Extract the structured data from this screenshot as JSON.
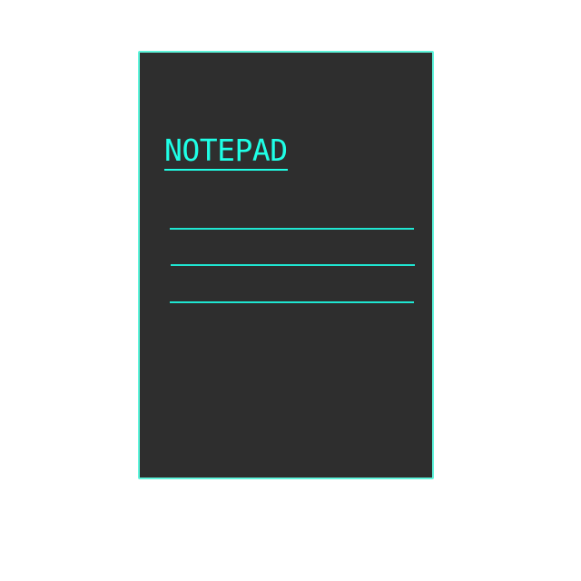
{
  "notepad": {
    "title": "NOTEPAD"
  },
  "colors": {
    "background": "#ffffff",
    "pad_fill": "#2e2e2e",
    "pad_border": "#5ff5dc",
    "accent": "#1fffe6"
  }
}
